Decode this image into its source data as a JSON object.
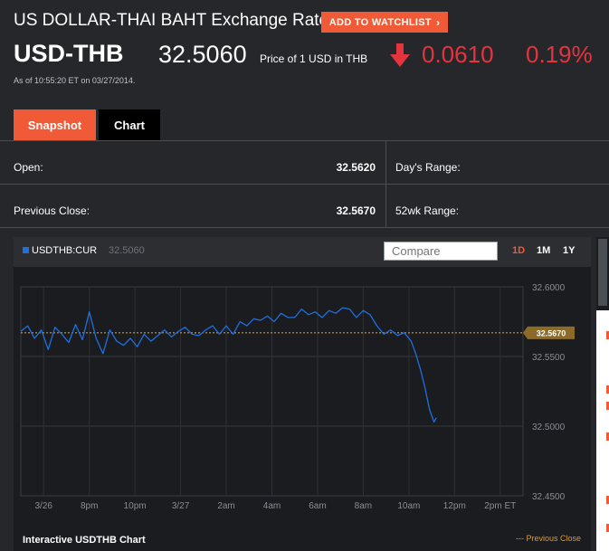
{
  "header": {
    "title": "US DOLLAR-THAI BAHT Exchange Rate",
    "watchlist_label": "ADD TO WATCHLIST",
    "watchlist_chevron": "›",
    "symbol": "USD-THB",
    "price": "32.5060",
    "price_desc": "Price of 1 USD in THB",
    "change": "0.0610",
    "change_pct": "0.19%",
    "change_direction": "down",
    "as_of": "As of 10:55:20 ET on 03/27/2014.",
    "colors": {
      "accent": "#f15a36",
      "negative": "#e5343e"
    }
  },
  "tabs": [
    {
      "label": "Snapshot",
      "active": true
    },
    {
      "label": "Chart",
      "active": false
    }
  ],
  "stats": {
    "open_label": "Open:",
    "open_value": "32.5620",
    "days_range_label": "Day's Range:",
    "prev_close_label": "Previous Close:",
    "prev_close_value": "32.5670",
    "wk52_range_label": "52wk Range:"
  },
  "chart": {
    "legend_ticker": "USDTHB:CUR",
    "legend_value": "32.5060",
    "compare_placeholder": "Compare",
    "ranges": [
      "1D",
      "1M",
      "1Y"
    ],
    "active_range": "1D",
    "footer_title": "Interactive USDTHB Chart",
    "footer_legend": "--- Previous Close",
    "prev_close_tag": "32.5670",
    "colors": {
      "line": "#1e6fe0",
      "prev_close": "#d89a3a",
      "tag_bg": "#8b6a2a"
    }
  },
  "chart_data": {
    "type": "line",
    "title": "",
    "xlabel": "",
    "ylabel": "",
    "ylim": [
      32.45,
      32.6
    ],
    "yticks": [
      "32.6000",
      "32.5500",
      "32.5000",
      "32.4500"
    ],
    "xticks": [
      "3/26",
      "8pm",
      "10pm",
      "3/27",
      "2am",
      "4am",
      "6am",
      "8am",
      "10am",
      "12pm",
      "2pm ET"
    ],
    "x_domain_hours": [
      0,
      22
    ],
    "xtick_hours": [
      1,
      3,
      5,
      7,
      9,
      11,
      13,
      15,
      17,
      19,
      21
    ],
    "previous_close": 32.567,
    "grid": true,
    "series": [
      {
        "name": "",
        "x": [
          0,
          0.3,
          0.6,
          0.9,
          1.2,
          1.5,
          1.8,
          2.1,
          2.4,
          2.7,
          3.0,
          3.3,
          3.6,
          3.9,
          4.2,
          4.5,
          4.8,
          5.1,
          5.4,
          5.7,
          6.0,
          6.3,
          6.6,
          6.9,
          7.2,
          7.5,
          7.8,
          8.1,
          8.4,
          8.7,
          9.0,
          9.3,
          9.6,
          9.9,
          10.2,
          10.5,
          10.8,
          11.1,
          11.4,
          11.7,
          12.0,
          12.3,
          12.6,
          12.9,
          13.2,
          13.5,
          13.8,
          14.1,
          14.4,
          14.7,
          15.0,
          15.3,
          15.6,
          15.9,
          16.2,
          16.5,
          16.8,
          17.1,
          17.3,
          17.5,
          17.7,
          17.9,
          18.1,
          18.2
        ],
        "values": [
          32.568,
          32.572,
          32.563,
          32.569,
          32.555,
          32.571,
          32.566,
          32.56,
          32.573,
          32.562,
          32.582,
          32.563,
          32.552,
          32.569,
          32.561,
          32.558,
          32.563,
          32.557,
          32.566,
          32.561,
          32.565,
          32.569,
          32.564,
          32.568,
          32.571,
          32.566,
          32.565,
          32.569,
          32.572,
          32.566,
          32.572,
          32.566,
          32.575,
          32.572,
          32.577,
          32.576,
          32.579,
          32.575,
          32.581,
          32.578,
          32.578,
          32.584,
          32.58,
          32.582,
          32.578,
          32.583,
          32.581,
          32.585,
          32.584,
          32.578,
          32.583,
          32.58,
          32.572,
          32.566,
          32.569,
          32.565,
          32.567,
          32.561,
          32.552,
          32.541,
          32.528,
          32.512,
          32.503,
          32.506
        ]
      }
    ]
  }
}
